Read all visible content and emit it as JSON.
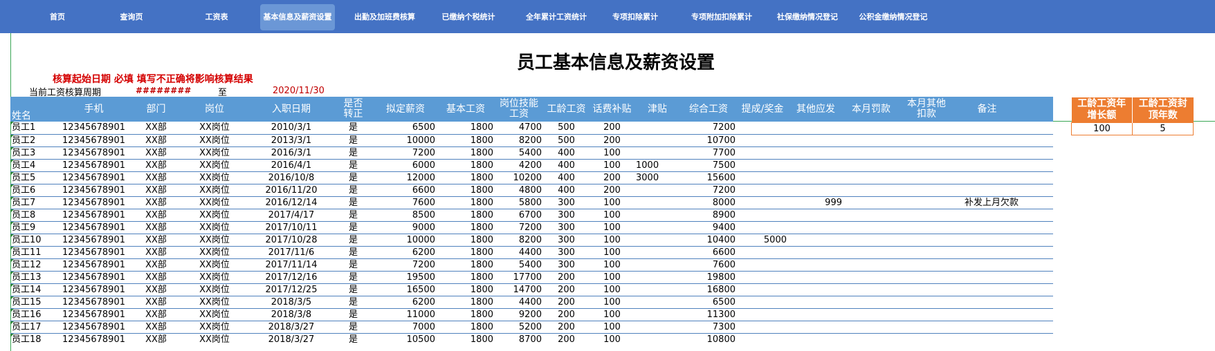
{
  "nav": [
    {
      "label": "首页"
    },
    {
      "label": "查询页"
    },
    {
      "label": "工资表"
    },
    {
      "label": "基本信息及薪资设置"
    },
    {
      "label": "出勤及加班费核算"
    },
    {
      "label": "已缴纳个税统计"
    },
    {
      "label": "全年累计工资统计"
    },
    {
      "label": "专项扣除累计"
    },
    {
      "label": "专项附加扣除累计"
    },
    {
      "label": "社保缴纳情况登记"
    },
    {
      "label": "公积金缴纳情况登记"
    }
  ],
  "title": "员工基本信息及薪资设置",
  "warning": "核算起始日期  必填  填写不正确将影响核算结果",
  "period": {
    "label": "当前工资核算周期",
    "start": "########",
    "to": "至",
    "end": "2020/11/30"
  },
  "columns": {
    "name": "姓名",
    "phone": "手机",
    "dept": "部门",
    "post": "岗位",
    "hire": "入职日期",
    "regular": "是否转正",
    "proposed": "拟定薪资",
    "base": "基本工资",
    "skill": "岗位技能工资",
    "seniority": "工龄工资",
    "phone_allow": "话费补贴",
    "allowance": "津贴",
    "total": "综合工资",
    "bonus": "提成/奖金",
    "other_pay": "其他应发",
    "fine": "本月罚款",
    "other_deduct": "本月其他扣款",
    "remark": "备注"
  },
  "rows": [
    {
      "name": "员工1",
      "phone": "12345678901",
      "dept": "XX部",
      "post": "XX岗位",
      "hire": "2010/3/1",
      "regular": "是",
      "proposed": "6500",
      "base": "1800",
      "skill": "4700",
      "seniority": "500",
      "phone_allow": "200",
      "allowance": "",
      "total": "7200",
      "bonus": "",
      "other_pay": "",
      "fine": "",
      "other_deduct": "",
      "remark": ""
    },
    {
      "name": "员工2",
      "phone": "12345678901",
      "dept": "XX部",
      "post": "XX岗位",
      "hire": "2013/3/1",
      "regular": "是",
      "proposed": "10000",
      "base": "1800",
      "skill": "8200",
      "seniority": "500",
      "phone_allow": "200",
      "allowance": "",
      "total": "10700",
      "bonus": "",
      "other_pay": "",
      "fine": "",
      "other_deduct": "",
      "remark": ""
    },
    {
      "name": "员工3",
      "phone": "12345678901",
      "dept": "XX部",
      "post": "XX岗位",
      "hire": "2016/3/1",
      "regular": "是",
      "proposed": "7200",
      "base": "1800",
      "skill": "5400",
      "seniority": "400",
      "phone_allow": "100",
      "allowance": "",
      "total": "7700",
      "bonus": "",
      "other_pay": "",
      "fine": "",
      "other_deduct": "",
      "remark": ""
    },
    {
      "name": "员工4",
      "phone": "12345678901",
      "dept": "XX部",
      "post": "XX岗位",
      "hire": "2016/4/1",
      "regular": "是",
      "proposed": "6000",
      "base": "1800",
      "skill": "4200",
      "seniority": "400",
      "phone_allow": "100",
      "allowance": "1000",
      "total": "7500",
      "bonus": "",
      "other_pay": "",
      "fine": "",
      "other_deduct": "",
      "remark": ""
    },
    {
      "name": "员工5",
      "phone": "12345678901",
      "dept": "XX部",
      "post": "XX岗位",
      "hire": "2016/10/8",
      "regular": "是",
      "proposed": "12000",
      "base": "1800",
      "skill": "10200",
      "seniority": "400",
      "phone_allow": "200",
      "allowance": "3000",
      "total": "15600",
      "bonus": "",
      "other_pay": "",
      "fine": "",
      "other_deduct": "",
      "remark": ""
    },
    {
      "name": "员工6",
      "phone": "12345678901",
      "dept": "XX部",
      "post": "XX岗位",
      "hire": "2016/11/20",
      "regular": "是",
      "proposed": "6600",
      "base": "1800",
      "skill": "4800",
      "seniority": "400",
      "phone_allow": "200",
      "allowance": "",
      "total": "7200",
      "bonus": "",
      "other_pay": "",
      "fine": "",
      "other_deduct": "",
      "remark": ""
    },
    {
      "name": "员工7",
      "phone": "12345678901",
      "dept": "XX部",
      "post": "XX岗位",
      "hire": "2016/12/14",
      "regular": "是",
      "proposed": "7600",
      "base": "1800",
      "skill": "5800",
      "seniority": "300",
      "phone_allow": "100",
      "allowance": "",
      "total": "8000",
      "bonus": "",
      "other_pay": "999",
      "fine": "",
      "other_deduct": "",
      "remark": "补发上月欠款"
    },
    {
      "name": "员工8",
      "phone": "12345678901",
      "dept": "XX部",
      "post": "XX岗位",
      "hire": "2017/4/17",
      "regular": "是",
      "proposed": "8500",
      "base": "1800",
      "skill": "6700",
      "seniority": "300",
      "phone_allow": "100",
      "allowance": "",
      "total": "8900",
      "bonus": "",
      "other_pay": "",
      "fine": "",
      "other_deduct": "",
      "remark": ""
    },
    {
      "name": "员工9",
      "phone": "12345678901",
      "dept": "XX部",
      "post": "XX岗位",
      "hire": "2017/10/11",
      "regular": "是",
      "proposed": "9000",
      "base": "1800",
      "skill": "7200",
      "seniority": "300",
      "phone_allow": "100",
      "allowance": "",
      "total": "9400",
      "bonus": "",
      "other_pay": "",
      "fine": "",
      "other_deduct": "",
      "remark": ""
    },
    {
      "name": "员工10",
      "phone": "12345678901",
      "dept": "XX部",
      "post": "XX岗位",
      "hire": "2017/10/28",
      "regular": "是",
      "proposed": "10000",
      "base": "1800",
      "skill": "8200",
      "seniority": "300",
      "phone_allow": "100",
      "allowance": "",
      "total": "10400",
      "bonus": "5000",
      "other_pay": "",
      "fine": "",
      "other_deduct": "",
      "remark": ""
    },
    {
      "name": "员工11",
      "phone": "12345678901",
      "dept": "XX部",
      "post": "XX岗位",
      "hire": "2017/11/6",
      "regular": "是",
      "proposed": "6200",
      "base": "1800",
      "skill": "4400",
      "seniority": "300",
      "phone_allow": "100",
      "allowance": "",
      "total": "6600",
      "bonus": "",
      "other_pay": "",
      "fine": "",
      "other_deduct": "",
      "remark": ""
    },
    {
      "name": "员工12",
      "phone": "12345678901",
      "dept": "XX部",
      "post": "XX岗位",
      "hire": "2017/11/14",
      "regular": "是",
      "proposed": "7200",
      "base": "1800",
      "skill": "5400",
      "seniority": "300",
      "phone_allow": "100",
      "allowance": "",
      "total": "7600",
      "bonus": "",
      "other_pay": "",
      "fine": "",
      "other_deduct": "",
      "remark": ""
    },
    {
      "name": "员工13",
      "phone": "12345678901",
      "dept": "XX部",
      "post": "XX岗位",
      "hire": "2017/12/16",
      "regular": "是",
      "proposed": "19500",
      "base": "1800",
      "skill": "17700",
      "seniority": "200",
      "phone_allow": "100",
      "allowance": "",
      "total": "19800",
      "bonus": "",
      "other_pay": "",
      "fine": "",
      "other_deduct": "",
      "remark": ""
    },
    {
      "name": "员工14",
      "phone": "12345678901",
      "dept": "XX部",
      "post": "XX岗位",
      "hire": "2017/12/25",
      "regular": "是",
      "proposed": "16500",
      "base": "1800",
      "skill": "14700",
      "seniority": "200",
      "phone_allow": "100",
      "allowance": "",
      "total": "16800",
      "bonus": "",
      "other_pay": "",
      "fine": "",
      "other_deduct": "",
      "remark": ""
    },
    {
      "name": "员工15",
      "phone": "12345678901",
      "dept": "XX部",
      "post": "XX岗位",
      "hire": "2018/3/5",
      "regular": "是",
      "proposed": "6200",
      "base": "1800",
      "skill": "4400",
      "seniority": "200",
      "phone_allow": "100",
      "allowance": "",
      "total": "6500",
      "bonus": "",
      "other_pay": "",
      "fine": "",
      "other_deduct": "",
      "remark": ""
    },
    {
      "name": "员工16",
      "phone": "12345678901",
      "dept": "XX部",
      "post": "XX岗位",
      "hire": "2018/3/8",
      "regular": "是",
      "proposed": "11000",
      "base": "1800",
      "skill": "9200",
      "seniority": "200",
      "phone_allow": "100",
      "allowance": "",
      "total": "11300",
      "bonus": "",
      "other_pay": "",
      "fine": "",
      "other_deduct": "",
      "remark": ""
    },
    {
      "name": "员工17",
      "phone": "12345678901",
      "dept": "XX部",
      "post": "XX岗位",
      "hire": "2018/3/27",
      "regular": "是",
      "proposed": "7000",
      "base": "1800",
      "skill": "5200",
      "seniority": "200",
      "phone_allow": "100",
      "allowance": "",
      "total": "7300",
      "bonus": "",
      "other_pay": "",
      "fine": "",
      "other_deduct": "",
      "remark": ""
    },
    {
      "name": "员工18",
      "phone": "12345678901",
      "dept": "XX部",
      "post": "XX岗位",
      "hire": "2018/3/27",
      "regular": "是",
      "proposed": "10500",
      "base": "1800",
      "skill": "8700",
      "seniority": "200",
      "phone_allow": "100",
      "allowance": "",
      "total": "10800",
      "bonus": "",
      "other_pay": "",
      "fine": "",
      "other_deduct": "",
      "remark": ""
    }
  ],
  "side": {
    "header_increase": "工龄工资年增长额",
    "header_cap": "工龄工资封顶年数",
    "increase": "100",
    "cap": "5"
  },
  "colors": {
    "nav_bg": "#4472c4",
    "nav_active": "#6b97d6",
    "header_bg": "#5b9bd5",
    "side_header_bg": "#ed7d31",
    "warning": "#d40000"
  }
}
